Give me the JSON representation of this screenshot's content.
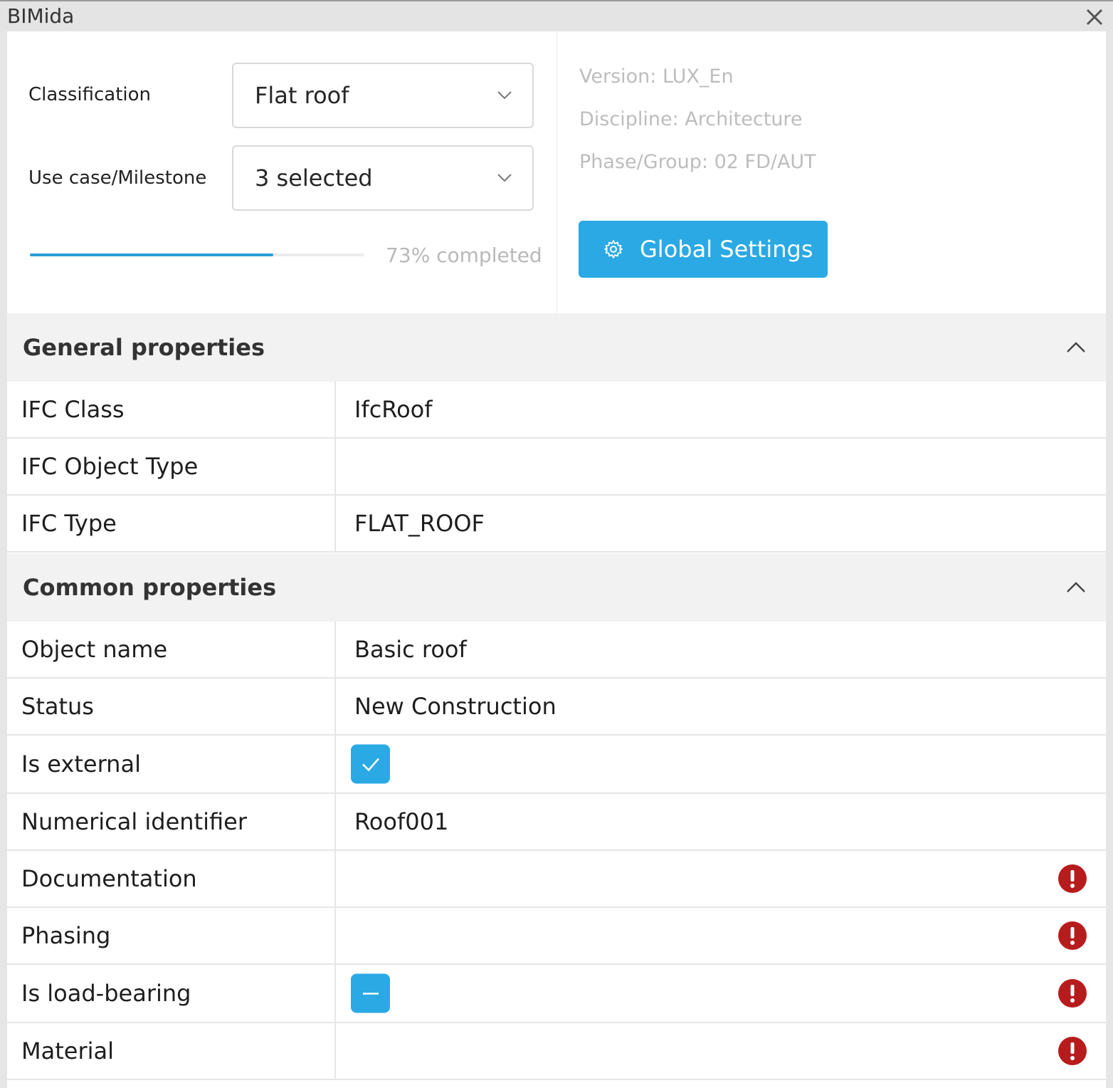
{
  "window": {
    "title": "BIMida"
  },
  "classification": {
    "label": "Classification",
    "value": "Flat roof"
  },
  "use_case": {
    "label": "Use case/Milestone",
    "value": "3 selected"
  },
  "progress": {
    "percent": 73,
    "text": "73% completed"
  },
  "info": {
    "version": "Version: LUX_En",
    "discipline": "Discipline: Architecture",
    "phase": "Phase/Group: 02 FD/AUT"
  },
  "global_settings": {
    "label": "Global Settings"
  },
  "general": {
    "title": "General properties",
    "rows": [
      {
        "key": "IFC Class",
        "value": "IfcRoof"
      },
      {
        "key": "IFC Object Type",
        "value": ""
      },
      {
        "key": "IFC Type",
        "value": "FLAT_ROOF"
      }
    ]
  },
  "common": {
    "title": "Common properties",
    "rows": [
      {
        "key": "Object name",
        "value": "Basic roof"
      },
      {
        "key": "Status",
        "value": "New Construction"
      },
      {
        "key": "Is external",
        "checkbox": "checked"
      },
      {
        "key": "Numerical identifier",
        "value": "Roof001"
      },
      {
        "key": "Documentation",
        "value": "",
        "error": true
      },
      {
        "key": "Phasing",
        "value": "",
        "error": true
      },
      {
        "key": "Is load-bearing",
        "checkbox": "indeterminate",
        "error": true
      },
      {
        "key": "Material",
        "value": "",
        "error": true
      }
    ]
  },
  "colors": {
    "accent": "#2aa9e4",
    "error": "#b71c1c",
    "progress": "#2a9fd8"
  }
}
